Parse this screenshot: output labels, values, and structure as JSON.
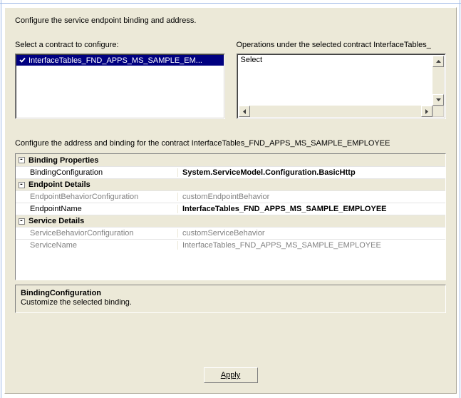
{
  "header": {
    "instruction": "Configure the service endpoint binding and address."
  },
  "contracts": {
    "label": "Select a contract to configure:",
    "selected": "InterfaceTables_FND_APPS_MS_SAMPLE_EM..."
  },
  "operations": {
    "label": "Operations under the selected contract  InterfaceTables_",
    "items": [
      "Select"
    ]
  },
  "addressSection": {
    "label": "Configure the address and binding for the contract  InterfaceTables_FND_APPS_MS_SAMPLE_EMPLOYEE"
  },
  "propertyGrid": {
    "categories": [
      {
        "name": "Binding Properties",
        "rows": [
          {
            "key": "BindingConfiguration",
            "keyDim": false,
            "value": "System.ServiceModel.Configuration.BasicHttp",
            "bold": true,
            "valDim": false
          }
        ]
      },
      {
        "name": "Endpoint Details",
        "rows": [
          {
            "key": "EndpointBehaviorConfiguration",
            "keyDim": true,
            "value": "customEndpointBehavior",
            "bold": false,
            "valDim": true
          },
          {
            "key": "EndpointName",
            "keyDim": false,
            "value": "InterfaceTables_FND_APPS_MS_SAMPLE_EMPLOYEE",
            "bold": true,
            "valDim": false
          }
        ]
      },
      {
        "name": "Service Details",
        "rows": [
          {
            "key": "ServiceBehaviorConfiguration",
            "keyDim": true,
            "value": "customServiceBehavior",
            "bold": false,
            "valDim": true
          },
          {
            "key": "ServiceName",
            "keyDim": true,
            "value": "InterfaceTables_FND_APPS_MS_SAMPLE_EMPLOYEE",
            "bold": false,
            "valDim": true
          }
        ]
      }
    ]
  },
  "help": {
    "title": "BindingConfiguration",
    "desc": "Customize the selected binding."
  },
  "buttons": {
    "apply": "Apply"
  }
}
